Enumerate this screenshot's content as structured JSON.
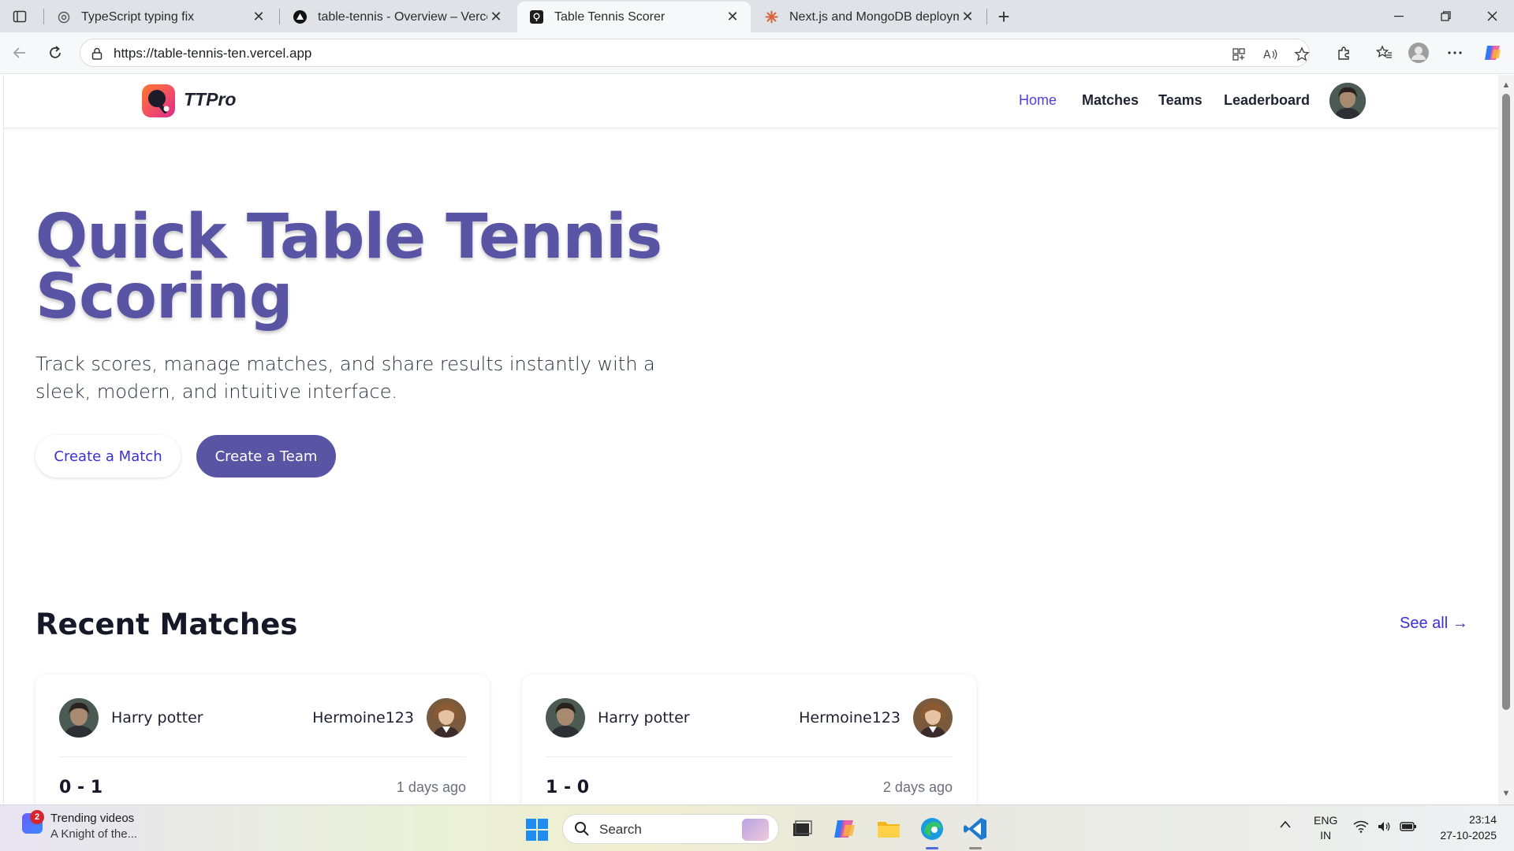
{
  "browser": {
    "tabs": [
      {
        "title": "TypeScript typing fix",
        "favicon": "openai-icon"
      },
      {
        "title": "table-tennis - Overview – Vercel",
        "favicon": "vercel-icon"
      },
      {
        "title": "Table Tennis Scorer",
        "favicon": "site-icon",
        "active": true
      },
      {
        "title": "Next.js and MongoDB deploymen",
        "favicon": "claude-icon"
      }
    ],
    "url": "https://table-tennis-ten.vercel.app"
  },
  "site": {
    "brand": "TTPro",
    "nav": [
      "Home",
      "Matches",
      "Teams",
      "Leaderboard"
    ],
    "active_nav": "Home",
    "accent_color": "#5a54a4",
    "link_color": "#3a2fd0"
  },
  "hero": {
    "title": "Quick Table Tennis Scoring",
    "subtitle": "Track scores, manage matches, and share results instantly with a sleek, modern, and intuitive interface.",
    "primary_button": "Create a Match",
    "secondary_button": "Create a Team"
  },
  "recent": {
    "title": "Recent Matches",
    "see_all": "See all →",
    "matches": [
      {
        "player1": "Harry potter",
        "player2": "Hermoine123",
        "score": "0 - 1",
        "ago": "1 days ago"
      },
      {
        "player1": "Harry potter",
        "player2": "Hermoine123",
        "score": "1 - 0",
        "ago": "2 days ago"
      }
    ]
  },
  "taskbar": {
    "news_count": "2",
    "news_title": "Trending videos",
    "news_sub": "A Knight of the...",
    "search": "Search",
    "lang1": "ENG",
    "lang2": "IN",
    "time": "23:14",
    "date": "27-10-2025"
  }
}
